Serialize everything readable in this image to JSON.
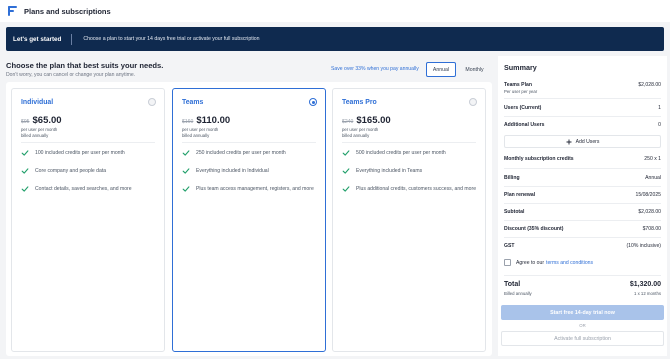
{
  "app": {
    "title": "Plans and subscriptions"
  },
  "banner": {
    "heading": "Let's get started",
    "message": "Choose a plan to start your 14 days free trial or activate your full subscription"
  },
  "choose": {
    "title": "Choose the plan that best suits your needs.",
    "subtitle": "Don't worry, you can cancel or change your plan anytime."
  },
  "billing_toggle": {
    "note": "Save over 33% when you pay annually",
    "annual_label": "Annual",
    "monthly_label": "Monthly",
    "selected": "Annual"
  },
  "plans": [
    {
      "name": "Individual",
      "old_price": "$95",
      "price": "$65.00",
      "per_line": "per user per month",
      "billed_line": "billed annually",
      "selected": false,
      "features": [
        "100 included credits per user per month",
        "Core company and people data",
        "Contact details, saved searches, and more"
      ]
    },
    {
      "name": "Teams",
      "old_price": "$160",
      "price": "$110.00",
      "per_line": "per user per month",
      "billed_line": "billed annually",
      "selected": true,
      "features": [
        "250 included credits per user per month",
        "Everything included in Individual",
        "Plus team access management, registers, and more"
      ]
    },
    {
      "name": "Teams Pro",
      "old_price": "$240",
      "price": "$165.00",
      "per_line": "per user per month",
      "billed_line": "billed annually",
      "selected": false,
      "features": [
        "500 included credits per user per month",
        "Everything included in Teams",
        "Plus additional credits, customers success, and more"
      ]
    }
  ],
  "summary": {
    "title": "Summary",
    "plan_label": "Teams Plan",
    "plan_sub": "Per user per year",
    "plan_value": "$2,028.00",
    "users_current_label": "Users (Current)",
    "users_current_value": "1",
    "additional_users_label": "Additional Users",
    "additional_users_value": "0",
    "add_users_label": "Add Users",
    "monthly_credits_label": "Monthly subscription credits",
    "monthly_credits_value": "250 x 1",
    "billing_label": "Billing",
    "billing_value": "Annual",
    "renewal_label": "Plan renewal",
    "renewal_value": "15/08/2025",
    "subtotal_label": "Subtotal",
    "subtotal_value": "$2,028.00",
    "discount_label": "Discount (35% discount)",
    "discount_value": "$708.00",
    "gst_label": "GST",
    "gst_value": "(10% inclusive)",
    "agree_text": "Agree to our",
    "terms_link": "terms and conditions",
    "total_label": "Total",
    "total_value": "$1,320.00",
    "total_sub_left": "Billed annually",
    "total_sub_right": "1 x 12 months",
    "trial_button": "Start free 14-day trial now",
    "or_text": "OR",
    "activate_button": "Activate full subscription"
  },
  "colors": {
    "accent": "#2f6fd6",
    "banner_bg": "#0f2a4f",
    "check_green": "#22a06b",
    "disabled_button": "#a9c3ea"
  },
  "icons": {
    "logo": "app-logo-icon",
    "check": "check-icon",
    "plus": "plus-icon"
  }
}
